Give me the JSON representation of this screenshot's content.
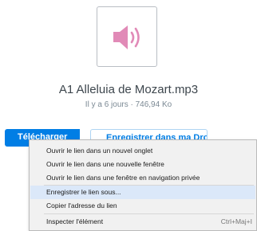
{
  "file": {
    "name": "A1 Alleluia de Mozart.mp3",
    "meta": "Il y a 6 jours · 746,94 Ko",
    "icon": "audio-file-icon",
    "icon_color": "#e18ab7"
  },
  "buttons": {
    "download_label": "Télécharger",
    "dropbox_label": "Enregistrer dans ma Dropbox"
  },
  "context_menu": {
    "items": [
      {
        "label": "Ouvrir le lien dans un nouvel onglet"
      },
      {
        "label": "Ouvrir le lien dans une nouvelle fenêtre"
      },
      {
        "label": "Ouvrir le lien dans une fenêtre en navigation privée"
      },
      {
        "label": "Enregistrer le lien sous..."
      },
      {
        "label": "Copier l'adresse du lien"
      },
      {
        "label": "Inspecter l'élément",
        "shortcut": "Ctrl+Maj+I"
      }
    ],
    "highlighted_label": "Enregistrer le lien sous..."
  }
}
